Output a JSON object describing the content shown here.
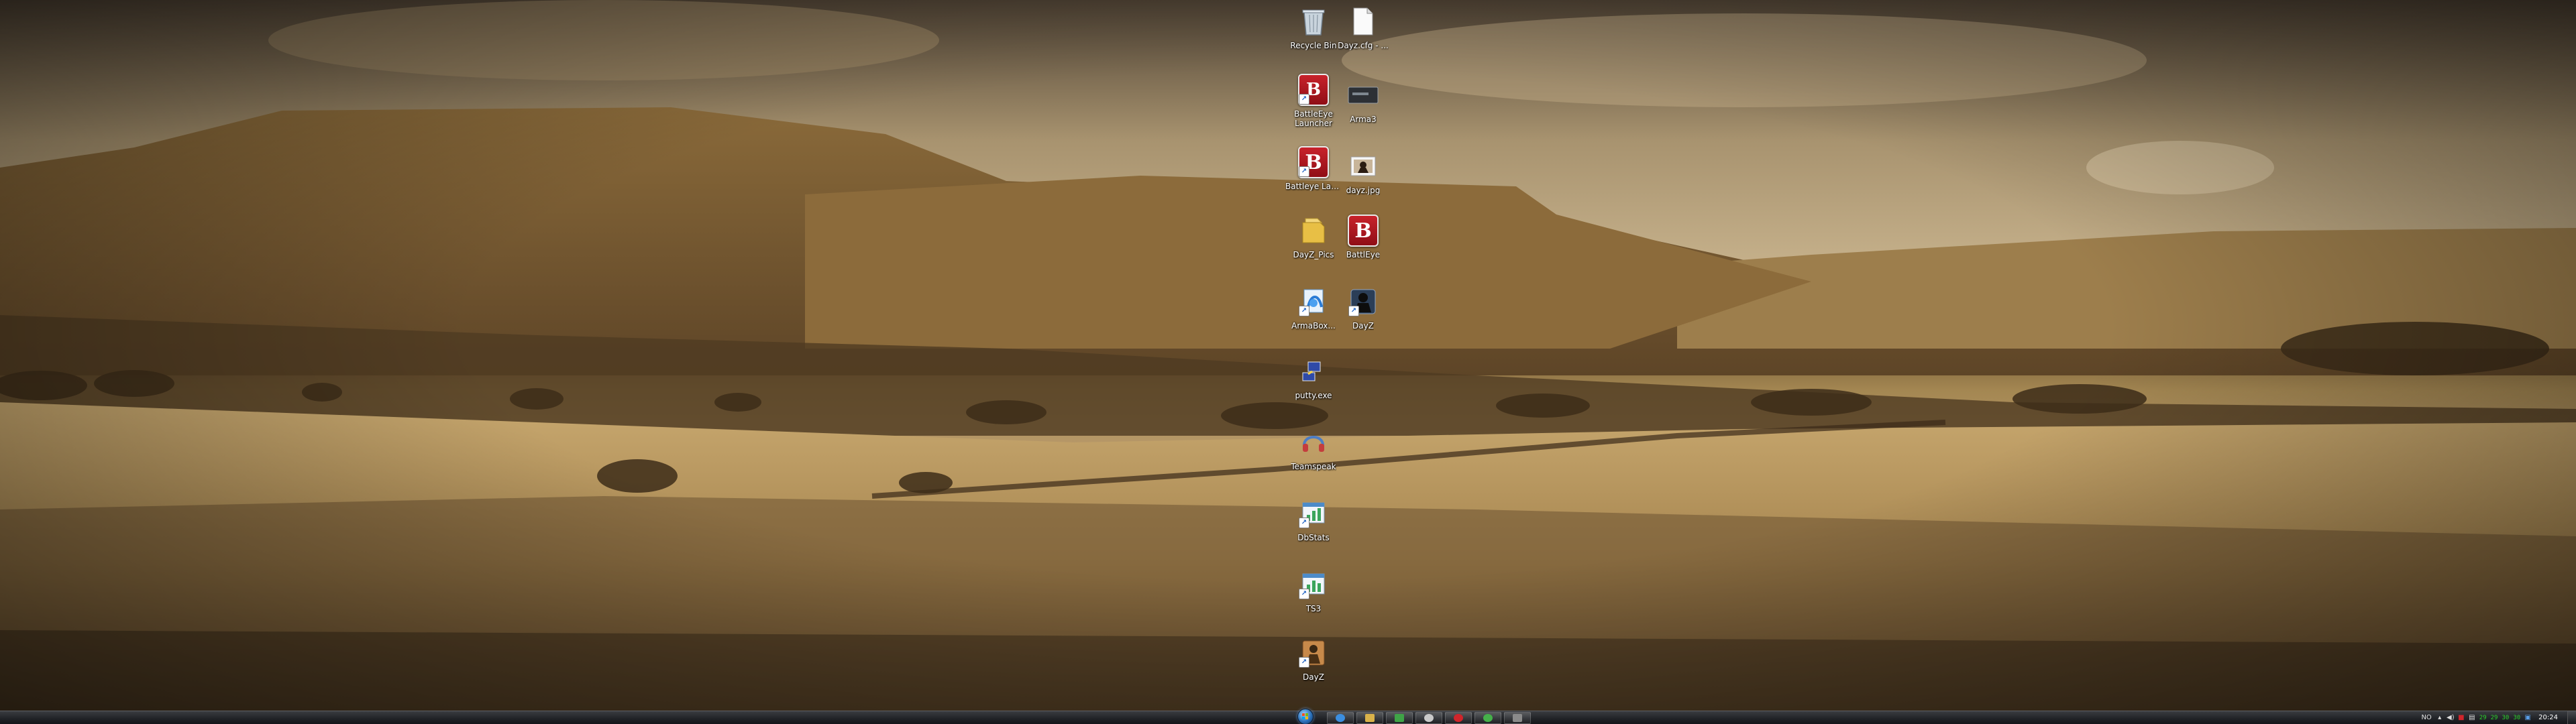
{
  "desktop": {
    "icons": [
      {
        "label": "Recycle Bin",
        "icon": "recycle-bin-icon"
      },
      {
        "label": "Dayz.cfg - ...",
        "icon": "text-file-icon"
      },
      {
        "label": "BattleEye Launcher",
        "icon": "battleye-icon"
      },
      {
        "label": "Arma3",
        "icon": "game-box-icon"
      },
      {
        "label": "Battleye Launcher DayZ",
        "icon": "battleye-icon"
      },
      {
        "label": "dayz.jpg",
        "icon": "image-file-icon"
      },
      {
        "label": "DayZ_Pics",
        "icon": "folder-icon"
      },
      {
        "label": "BattlEye",
        "icon": "battleye-icon"
      },
      {
        "label": "ArmaBox...",
        "icon": "application-icon"
      },
      {
        "label": "DayZ",
        "icon": "soldier-icon"
      },
      {
        "label": "putty.exe",
        "icon": "network-computer-icon"
      },
      {
        "label": "Teamspeak",
        "icon": "teamspeak-icon"
      },
      {
        "label": "DbStats",
        "icon": "chart-window-icon"
      },
      {
        "label": "TS3",
        "icon": "chart-window-icon"
      },
      {
        "label": "DayZ",
        "icon": "dayz-character-icon"
      }
    ]
  },
  "taskbar": {
    "start_icon": "windows-orb-icon",
    "pinned": [
      {
        "icon": "ie-icon",
        "color": "#3b8ee0"
      },
      {
        "icon": "explorer-icon",
        "color": "#d9b24a"
      },
      {
        "icon": "media-icon",
        "color": "#3fa447"
      },
      {
        "icon": "steam-icon",
        "color": "#c9c9c9"
      },
      {
        "icon": "opera-icon",
        "color": "#d0252b"
      },
      {
        "icon": "game-icon",
        "color": "#45b04a"
      },
      {
        "icon": "app-icon",
        "color": "#8a8a8a"
      }
    ],
    "tray": {
      "language": "NO",
      "numbers": [
        "29",
        "29",
        "30",
        "30"
      ],
      "time": "20:24"
    }
  }
}
